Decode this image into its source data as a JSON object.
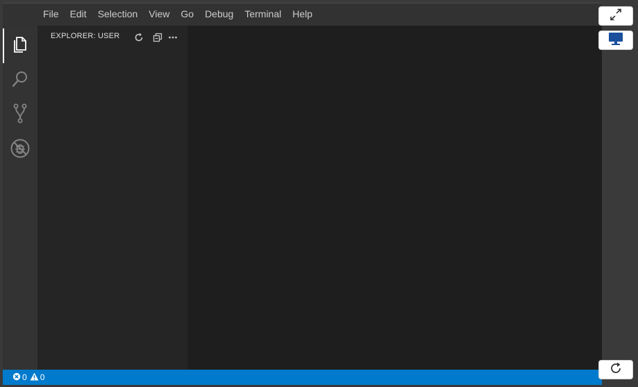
{
  "menubar": {
    "items": [
      "File",
      "Edit",
      "Selection",
      "View",
      "Go",
      "Debug",
      "Terminal",
      "Help"
    ]
  },
  "activitybar": {
    "items": [
      {
        "icon": "files-icon",
        "active": true
      },
      {
        "icon": "search-icon",
        "active": false
      },
      {
        "icon": "source-control-icon",
        "active": false
      },
      {
        "icon": "debug-icon",
        "active": false
      }
    ]
  },
  "sidebar": {
    "title": "EXPLORER: USER",
    "actions": [
      "refresh-icon",
      "collapse-all-icon",
      "more-icon"
    ]
  },
  "statusbar": {
    "errors": "0",
    "warnings": "0"
  },
  "colors": {
    "accent": "#007acc",
    "editor_bg": "#1e1e1e",
    "sidebar_bg": "#252526",
    "activitybar_bg": "#333333",
    "menubar_bg": "#323233",
    "monitor_icon": "#1b4f9c"
  },
  "side_controls": [
    "fullscreen-icon",
    "monitor-icon",
    "reload-icon"
  ]
}
